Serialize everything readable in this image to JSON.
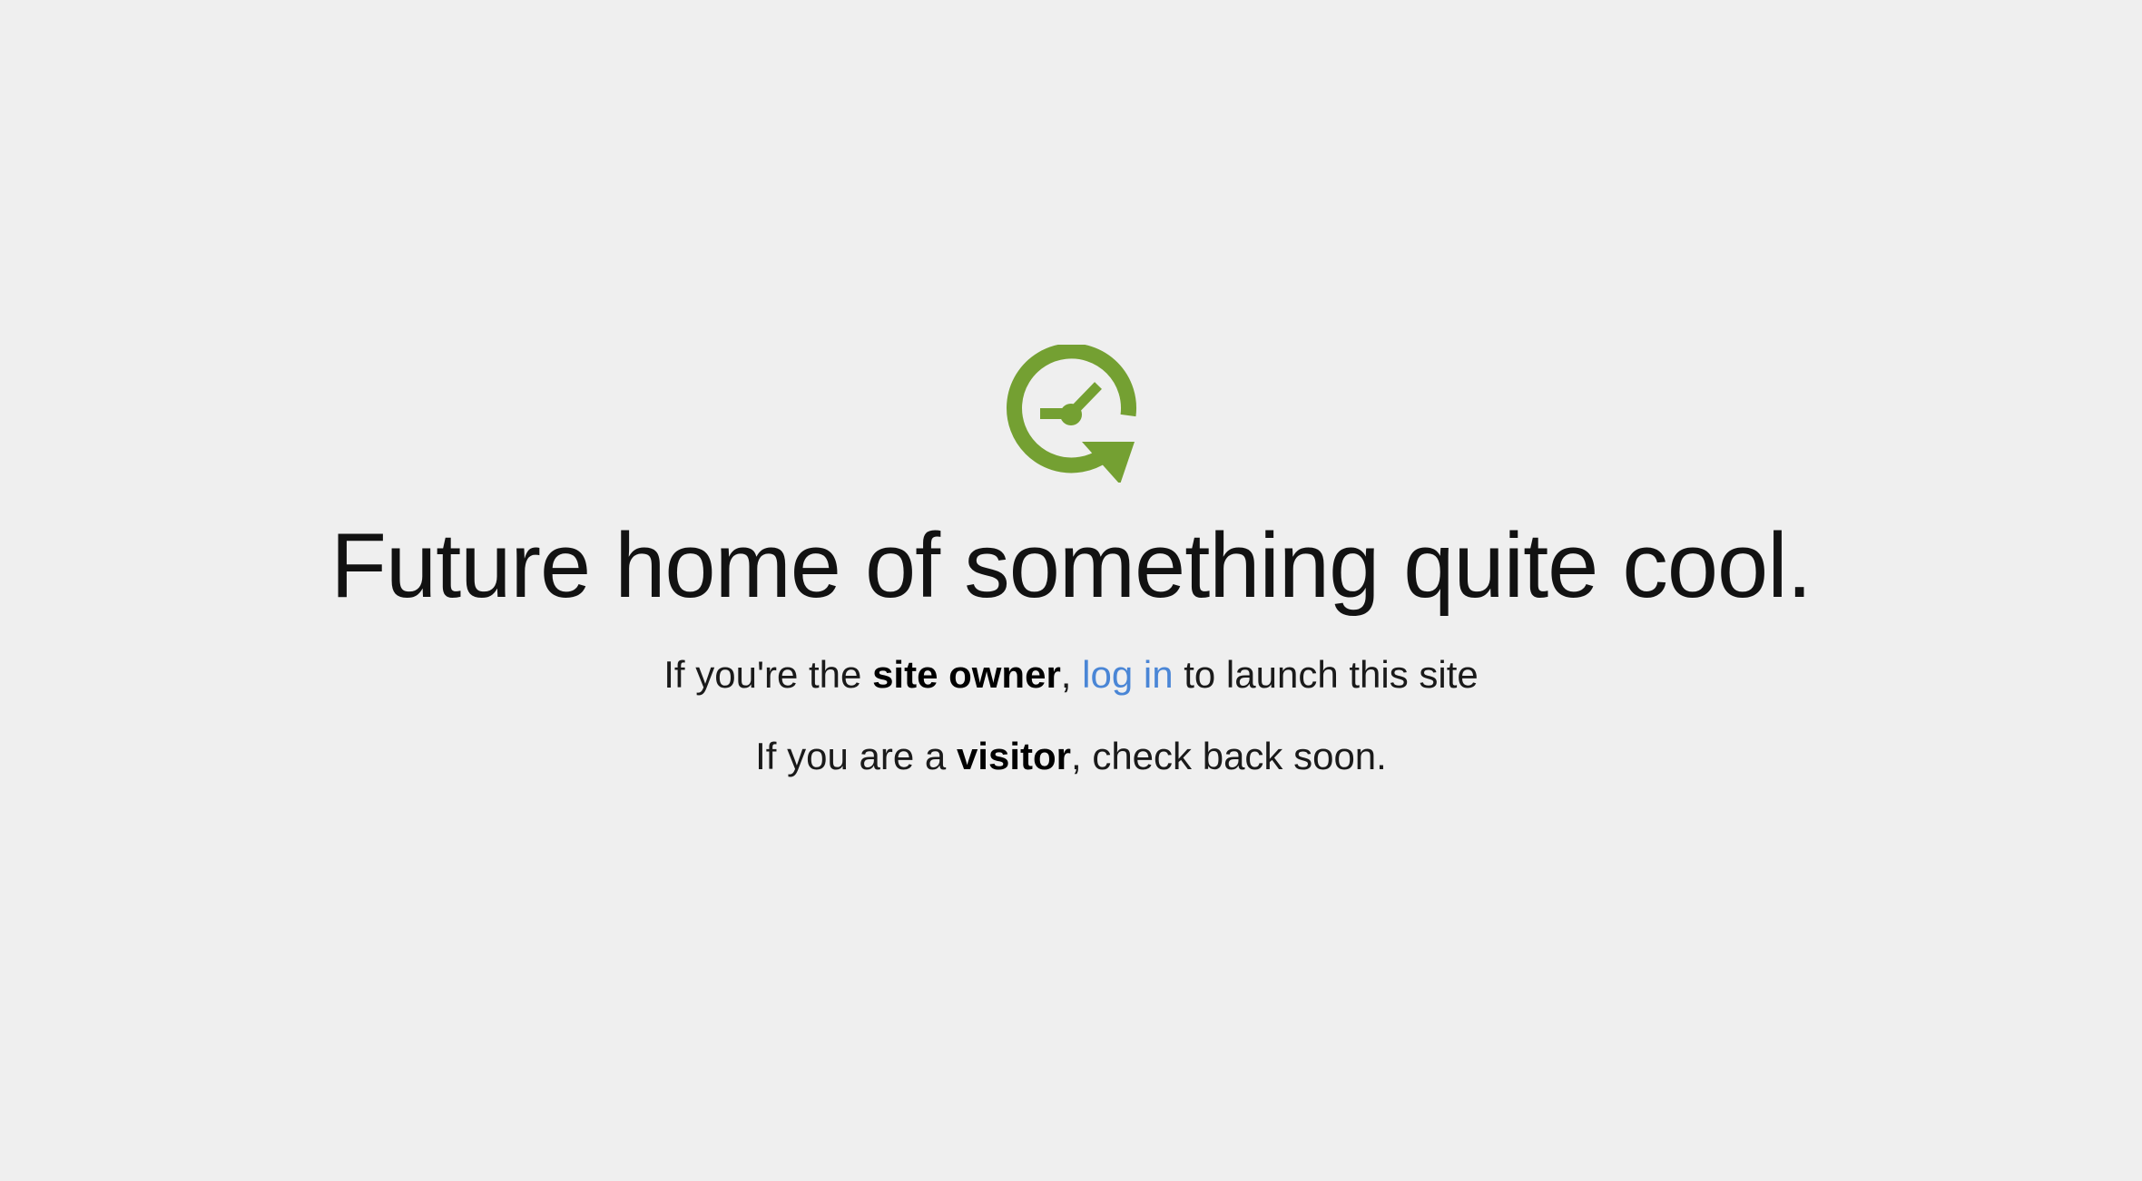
{
  "logo": {
    "icon": "clock-refresh-icon",
    "color": "#74a032"
  },
  "headline": "Future home of something quite cool.",
  "owner_line": {
    "prefix": "If you're the ",
    "bold": "site owner",
    "comma": ", ",
    "link": "log in",
    "suffix": " to launch this site"
  },
  "visitor_line": {
    "prefix": "If you are a ",
    "bold": "visitor",
    "suffix": ", check back soon."
  },
  "colors": {
    "background": "#efefef",
    "link": "#4a86d6",
    "brand": "#74a032"
  }
}
